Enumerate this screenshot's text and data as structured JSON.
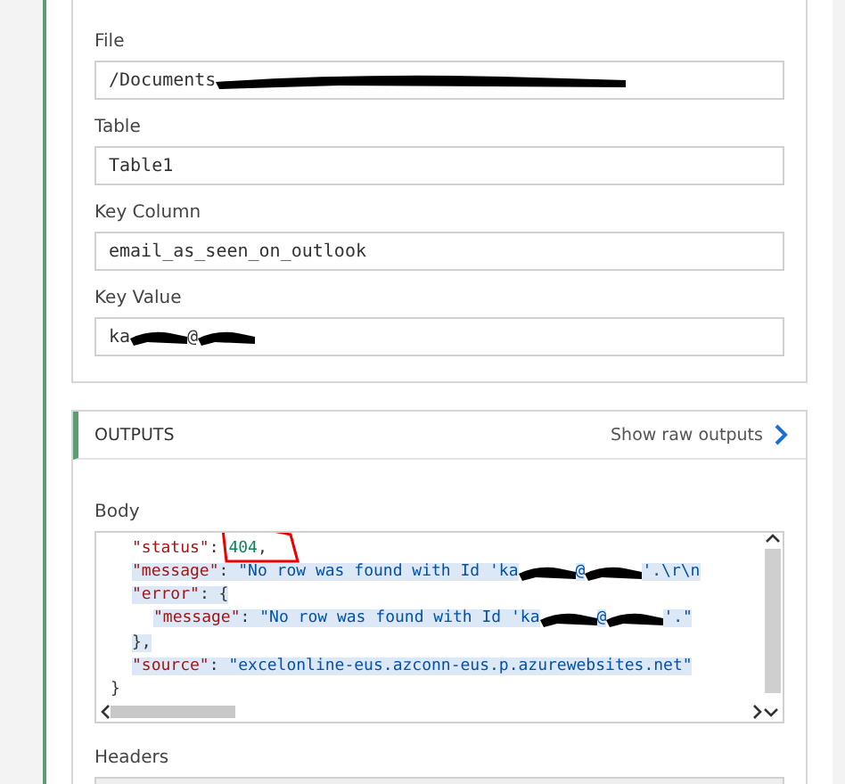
{
  "inputs": {
    "fields": [
      {
        "label": "File",
        "value": [
          {
            "kind": "text",
            "text": "/Documents"
          },
          {
            "kind": "redacted-long"
          }
        ]
      },
      {
        "label": "Table",
        "value": [
          {
            "kind": "text",
            "text": "Table1"
          }
        ]
      },
      {
        "label": "Key Column",
        "value": [
          {
            "kind": "text",
            "text": "email_as_seen_on_outlook"
          }
        ]
      },
      {
        "label": "Key Value",
        "value": [
          {
            "kind": "text",
            "text": "ka"
          },
          {
            "kind": "redacted"
          },
          {
            "kind": "text",
            "text": "@"
          },
          {
            "kind": "redacted"
          }
        ]
      }
    ]
  },
  "outputs": {
    "title": "OUTPUTS",
    "raw_link": "Show raw outputs",
    "body": {
      "label": "Body",
      "lines": [
        {
          "selected": false,
          "tokens": [
            {
              "kind": "key",
              "text": "\"status\""
            },
            {
              "kind": "punct",
              "text": ": "
            },
            {
              "kind": "number",
              "text": "404",
              "circled": true
            },
            {
              "kind": "punct",
              "text": ","
            }
          ]
        },
        {
          "selected": true,
          "tokens": [
            {
              "kind": "key",
              "text": "\"message\""
            },
            {
              "kind": "punct",
              "text": ": "
            },
            {
              "kind": "string",
              "text": "\"No row was found with Id 'ka"
            },
            {
              "kind": "redacted"
            },
            {
              "kind": "string",
              "text": "@"
            },
            {
              "kind": "redacted"
            },
            {
              "kind": "string",
              "text": "'.\\r\\n"
            }
          ]
        },
        {
          "selected": true,
          "tokens": [
            {
              "kind": "key",
              "text": "\"error\""
            },
            {
              "kind": "punct",
              "text": ": {"
            }
          ],
          "children": [
            {
              "selected": true,
              "tokens": [
                {
                  "kind": "key",
                  "text": "\"message\""
                },
                {
                  "kind": "punct",
                  "text": ": "
                },
                {
                  "kind": "string",
                  "text": "\"No row was found with Id 'ka"
                },
                {
                  "kind": "redacted"
                },
                {
                  "kind": "string",
                  "text": "@"
                },
                {
                  "kind": "redacted"
                },
                {
                  "kind": "string",
                  "text": "'.\""
                }
              ]
            }
          ]
        },
        {
          "selected": true,
          "tokens": [
            {
              "kind": "punct",
              "text": "},"
            }
          ]
        },
        {
          "selected": true,
          "tokens": [
            {
              "kind": "key",
              "text": "\"source\""
            },
            {
              "kind": "punct",
              "text": ": "
            },
            {
              "kind": "string",
              "text": "\"excelonline-eus.azconn-eus.p.azurewebsites.net\""
            }
          ]
        }
      ],
      "closing": "}"
    },
    "headers": {
      "label": "Headers"
    }
  }
}
